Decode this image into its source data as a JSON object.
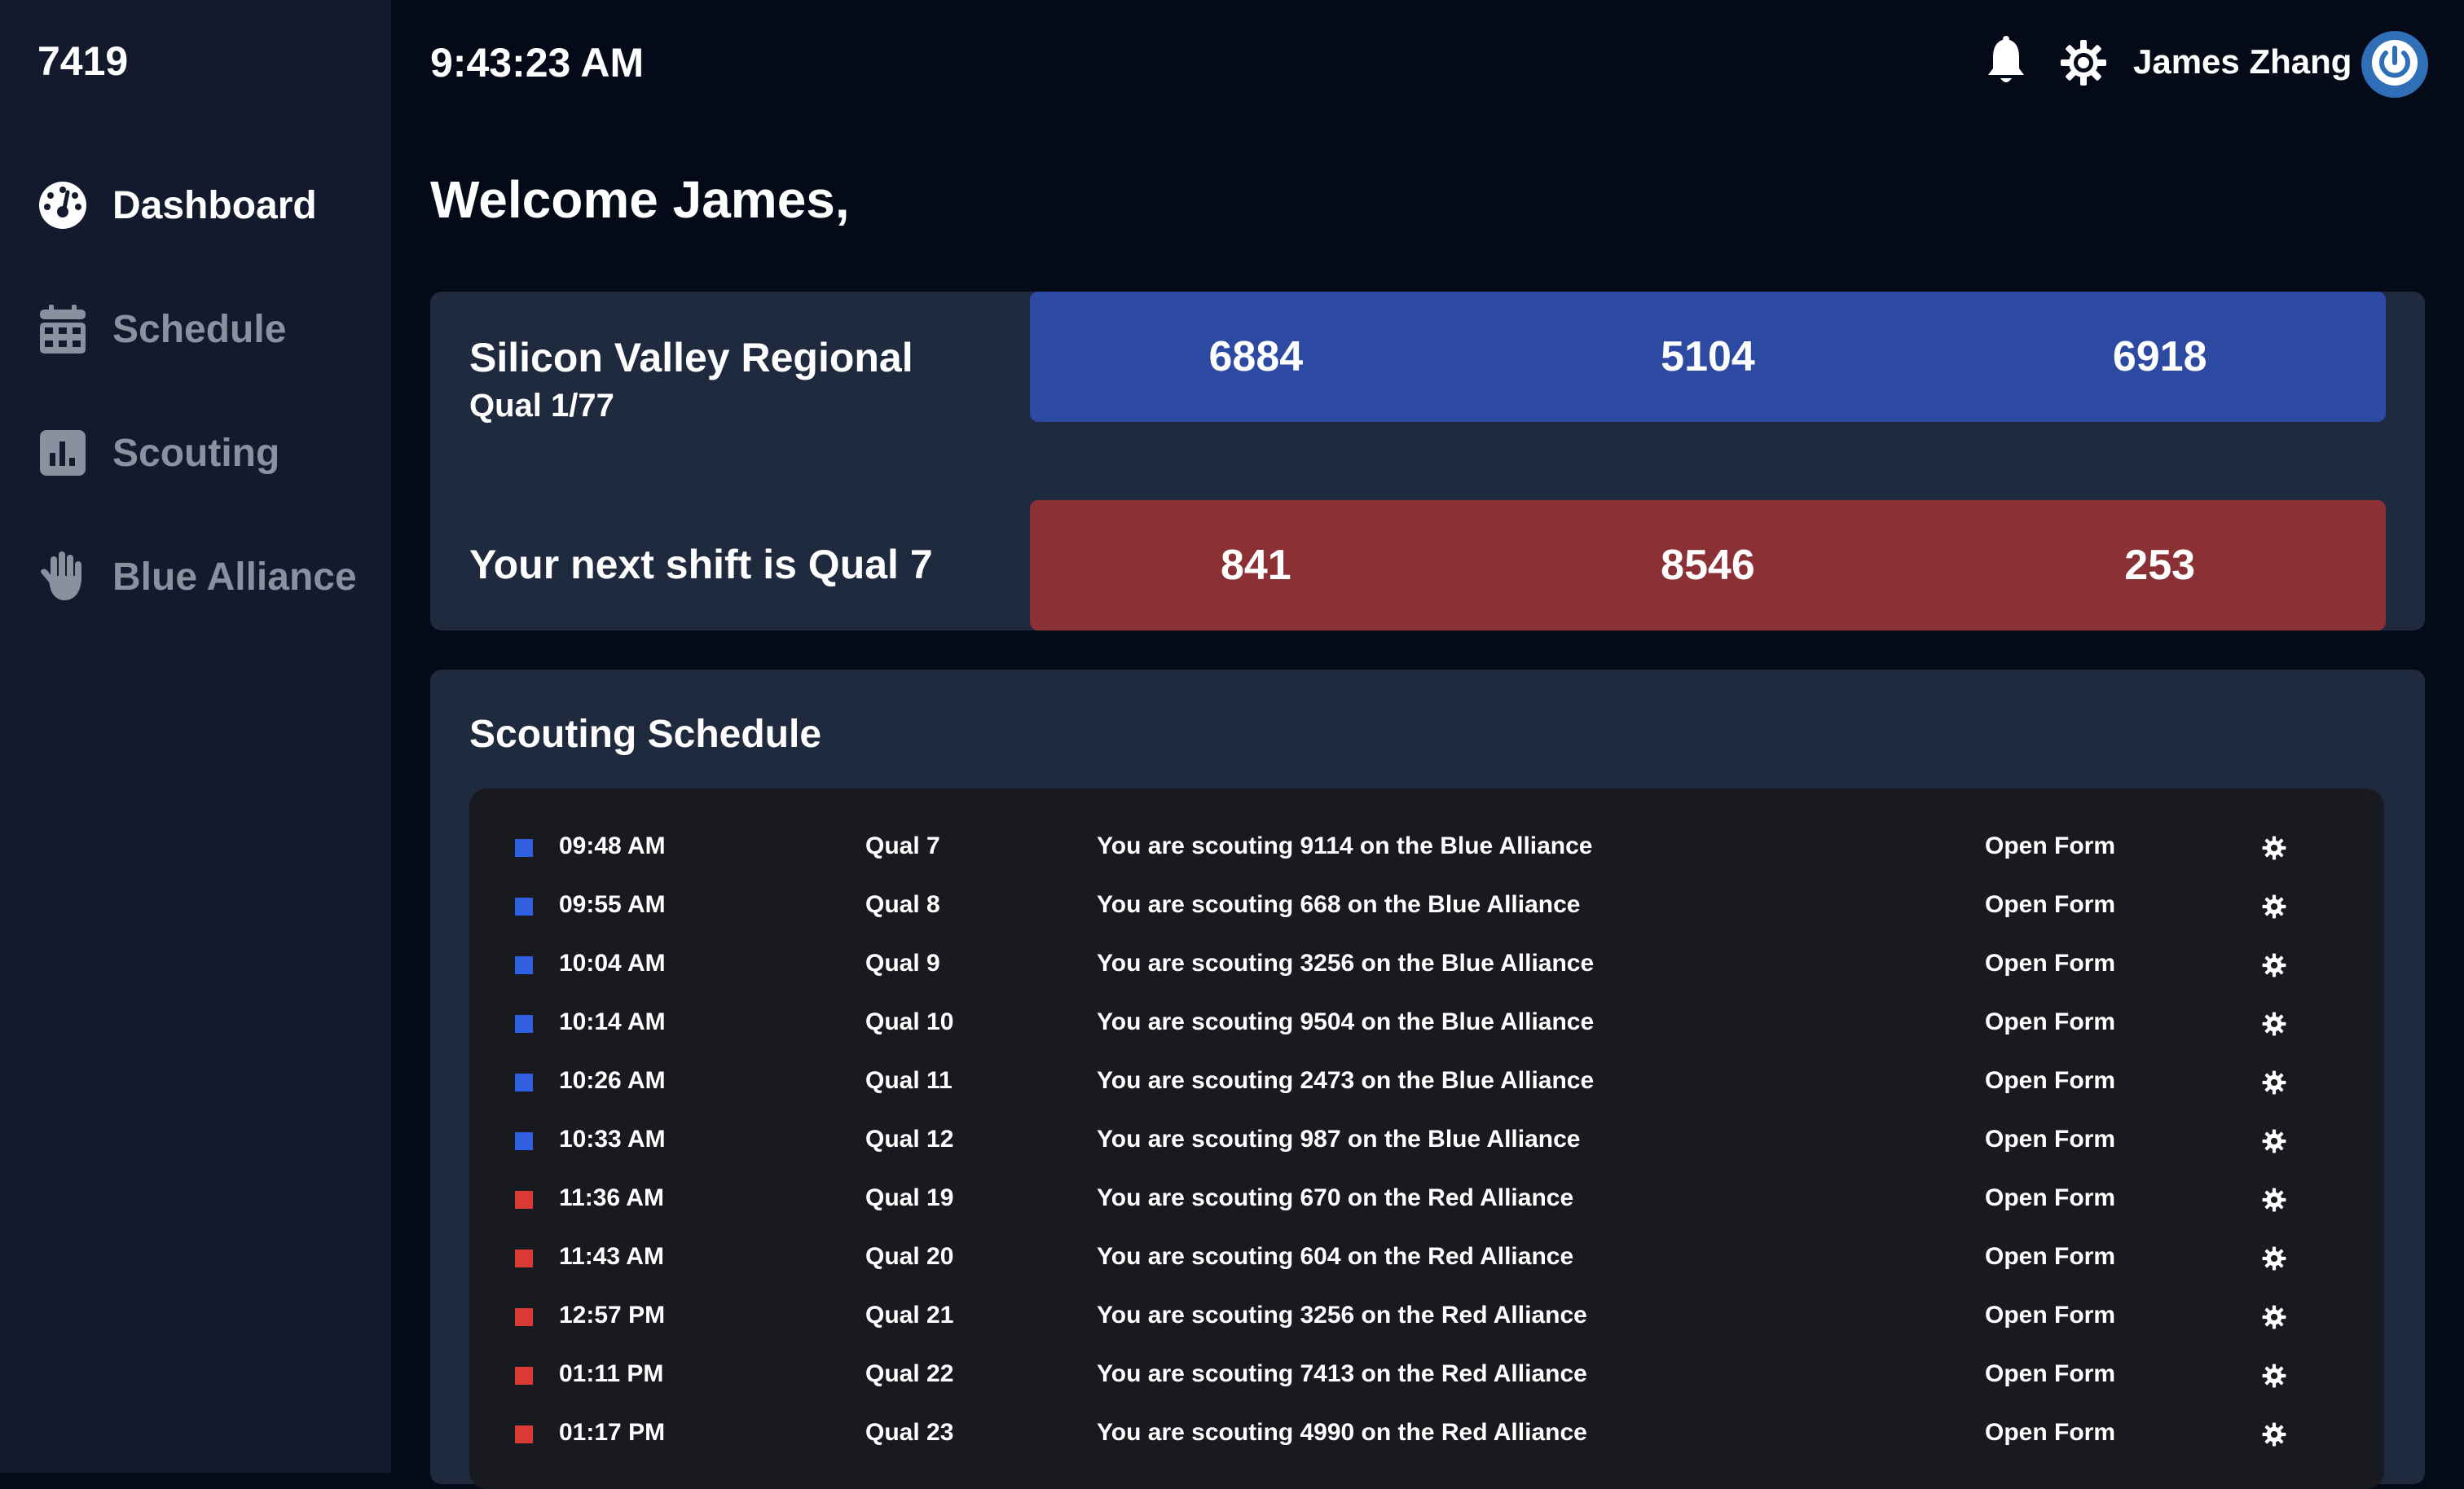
{
  "app": {
    "team_number": "7419"
  },
  "sidebar": {
    "items": [
      {
        "label": "Dashboard",
        "icon": "dashboard-gauge-icon",
        "active": true
      },
      {
        "label": "Schedule",
        "icon": "calendar-icon",
        "active": false
      },
      {
        "label": "Scouting",
        "icon": "bar-chart-icon",
        "active": false
      },
      {
        "label": "Blue Alliance",
        "icon": "hand-icon",
        "active": false
      }
    ]
  },
  "header": {
    "time": "9:43:23 AM",
    "user_name": "James Zhang",
    "icons": [
      "bell-icon",
      "gear-icon",
      "power-icon"
    ]
  },
  "welcome": "Welcome James,",
  "match_card": {
    "event_name": "Silicon Valley Regional",
    "qual_progress": "Qual 1/77",
    "next_shift": "Your next shift is Qual 7",
    "blue_alliance": [
      "6884",
      "5104",
      "6918"
    ],
    "red_alliance": [
      "841",
      "8546",
      "253"
    ]
  },
  "schedule": {
    "title": "Scouting Schedule",
    "rows": [
      {
        "alliance": "blue",
        "time": "09:48 AM",
        "match": "Qual 7",
        "description": "You are scouting 9114 on the Blue Alliance",
        "action": "Open Form"
      },
      {
        "alliance": "blue",
        "time": "09:55 AM",
        "match": "Qual 8",
        "description": "You are scouting 668 on the Blue Alliance",
        "action": "Open Form"
      },
      {
        "alliance": "blue",
        "time": "10:04 AM",
        "match": "Qual 9",
        "description": "You are scouting 3256 on the Blue Alliance",
        "action": "Open Form"
      },
      {
        "alliance": "blue",
        "time": "10:14 AM",
        "match": "Qual 10",
        "description": "You are scouting 9504 on the Blue Alliance",
        "action": "Open Form"
      },
      {
        "alliance": "blue",
        "time": "10:26 AM",
        "match": "Qual 11",
        "description": "You are scouting 2473 on the Blue Alliance",
        "action": "Open Form"
      },
      {
        "alliance": "blue",
        "time": "10:33 AM",
        "match": "Qual 12",
        "description": "You are scouting 987 on the Blue Alliance",
        "action": "Open Form"
      },
      {
        "alliance": "red",
        "time": "11:36 AM",
        "match": "Qual 19",
        "description": "You are scouting 670 on the Red Alliance",
        "action": "Open Form"
      },
      {
        "alliance": "red",
        "time": "11:43 AM",
        "match": "Qual 20",
        "description": "You are scouting 604 on the Red Alliance",
        "action": "Open Form"
      },
      {
        "alliance": "red",
        "time": "12:57 PM",
        "match": "Qual 21",
        "description": "You are scouting 3256 on the Red Alliance",
        "action": "Open Form"
      },
      {
        "alliance": "red",
        "time": "01:11 PM",
        "match": "Qual 22",
        "description": "You are scouting 7413 on the Red Alliance",
        "action": "Open Form"
      },
      {
        "alliance": "red",
        "time": "01:17 PM",
        "match": "Qual 23",
        "description": "You are scouting 4990 on the Red Alliance",
        "action": "Open Form"
      }
    ]
  },
  "colors": {
    "background": "#050a18",
    "sidebar": "#141a2e",
    "card": "#202a3e",
    "table": "#181a1f",
    "blue_alliance": "#2d4aa3",
    "red_alliance": "#8b3035",
    "blue_marker": "#2f5fe0",
    "red_marker": "#d93a36",
    "accent": "#2e6fb8"
  }
}
